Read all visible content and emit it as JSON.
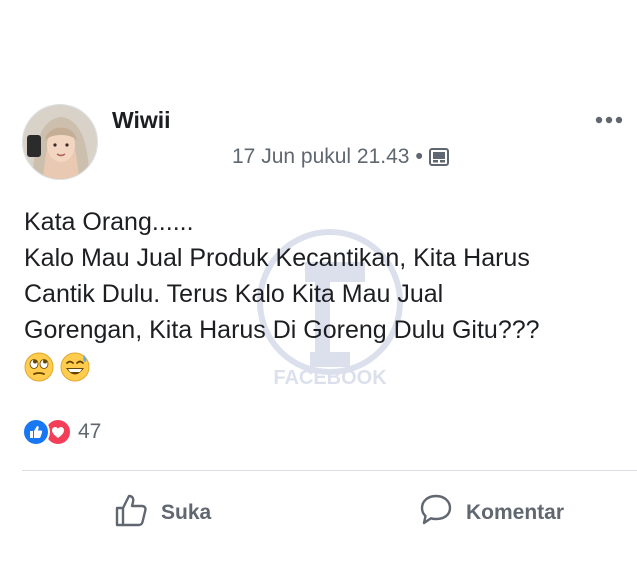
{
  "post": {
    "author": "Wiwii",
    "timestamp": "17 Jun pukul 21.43",
    "separator": "•",
    "privacy_icon": "photo-album-icon",
    "lines": [
      "Kata Orang......",
      "Kalo Mau Jual Produk Kecantikan, Kita Harus",
      "Cantik Dulu. Terus Kalo Kita Mau Jual",
      "Gorengan, Kita Harus Di Goreng Dulu Gitu???"
    ],
    "emojis": [
      "face-with-rolling-eyes",
      "grinning-face-with-sweat"
    ]
  },
  "reactions": {
    "types": [
      "like",
      "love"
    ],
    "count": "47"
  },
  "actions": {
    "like_label": "Suka",
    "comment_label": "Komentar"
  },
  "watermark": {
    "text": "FACEBOOK",
    "letter": "f"
  },
  "colors": {
    "like_blue": "#1877f2",
    "love_red": "#f33e58",
    "meta_gray": "#606770",
    "text": "#1c1e21"
  }
}
